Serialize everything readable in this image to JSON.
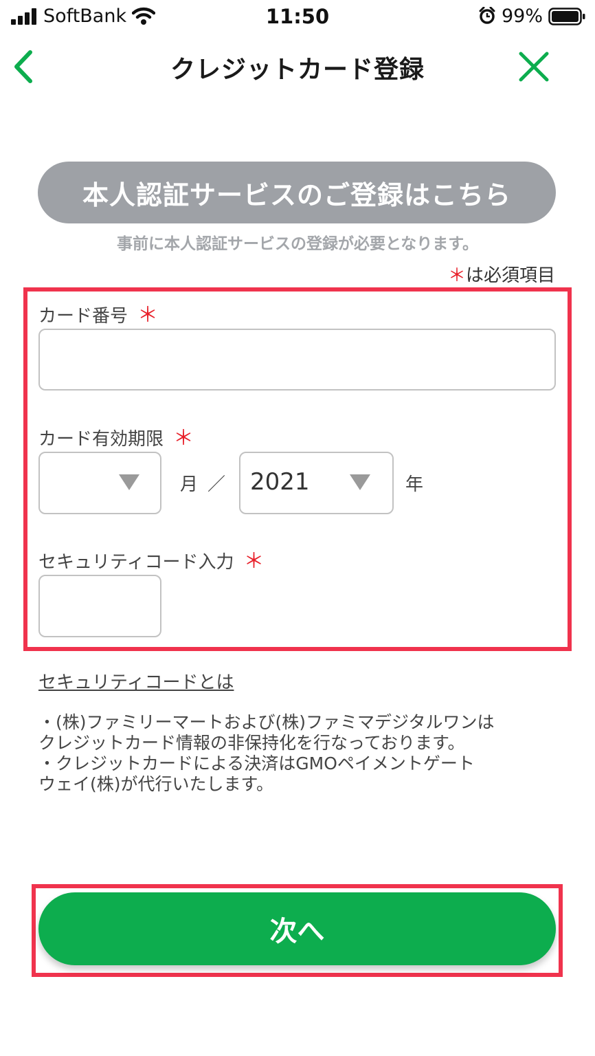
{
  "status_bar": {
    "carrier": "SoftBank",
    "time": "11:50",
    "battery": "99%"
  },
  "nav": {
    "title": "クレジットカード登録",
    "back_icon": "chevron-left-icon",
    "close_icon": "close-icon",
    "accent_color": "#0dad4e"
  },
  "verification": {
    "button_label": "本人認証サービスのご登録はこちら",
    "note": "事前に本人認証サービスの登録が必要となります。"
  },
  "required_note": {
    "mark": "＊",
    "text": "は必須項目"
  },
  "form": {
    "card_number_label": "カード番号",
    "card_number_value": "",
    "expiry_label": "カード有効期限",
    "expiry_month_value": "",
    "month_unit": "月",
    "separator": "／",
    "expiry_year_value": "2021",
    "year_unit": "年",
    "security_label": "セキュリティコード入力",
    "security_value": "",
    "required_mark": "＊"
  },
  "security_link": "セキュリティコードとは",
  "notice": [
    "・(株)ファミリーマートおよび(株)ファミマデジタルワンは",
    "クレジットカード情報の非保持化を行なっております。",
    "・クレジットカードによる決済はGMOペイメントゲート",
    "ウェイ(株)が代行いたします。"
  ],
  "next_button_label": "次へ",
  "colors": {
    "highlight": "#f0334d",
    "required": "#e8202a",
    "verify_button": "#9ea1a6"
  }
}
